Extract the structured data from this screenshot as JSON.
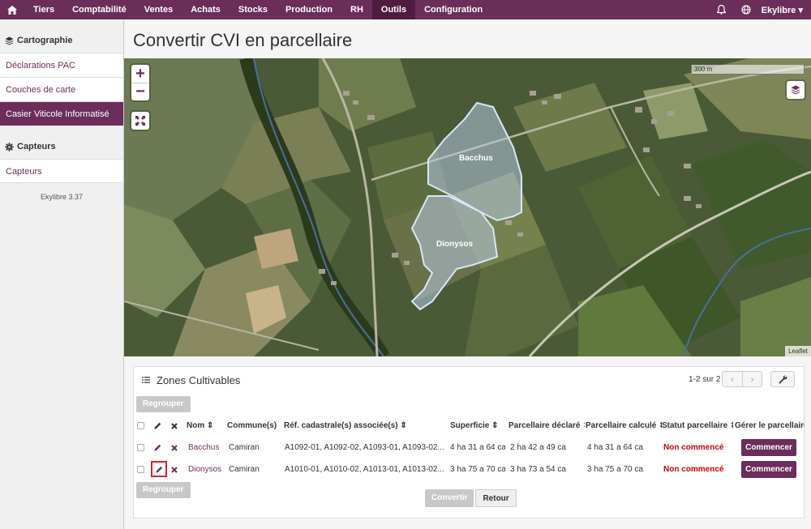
{
  "nav": {
    "items": [
      "Tiers",
      "Comptabilité",
      "Ventes",
      "Achats",
      "Stocks",
      "Production",
      "RH",
      "Outils",
      "Configuration"
    ],
    "active": "Outils",
    "user": "Ekylibre ▾"
  },
  "sidebar": {
    "section1": "Cartographie",
    "items1": [
      "Déclarations PAC",
      "Couches de carte",
      "Casier Viticole Informatisé"
    ],
    "section2": "Capteurs",
    "items2": [
      "Capteurs"
    ],
    "version": "Ekylibre 3.37"
  },
  "page": {
    "title": "Convertir CVI en parcellaire"
  },
  "map": {
    "scale_label": "300 m",
    "attribution": "Leaflet",
    "parcels": [
      "Bacchus",
      "Dionysos"
    ]
  },
  "panel": {
    "title": "Zones Cultivables",
    "count": "1-2 sur 2",
    "group_button": "Regrouper",
    "columns": {
      "name": "Nom ⇕",
      "commune": "Commune(s) ⇕",
      "ref": "Réf. cadastrale(s) associée(s) ⇕",
      "surface": "Superficie ⇕",
      "declared": "Parcellaire déclaré ⇕",
      "computed": "Parcellaire calculé ⇕",
      "status": "Statut parcellaire ⇕",
      "manage": "Gérer le parcellaire"
    },
    "rows": [
      {
        "name": "Bacchus",
        "commune": "Camiran",
        "ref": "A1092-01, A1092-02, A1093-01, A1093-02...",
        "surface": "4 ha 31 a 64 ca",
        "declared": "2 ha 42 a 49 ca",
        "computed": "4 ha 31 a 64 ca",
        "status": "Non commencé",
        "action": "Commencer"
      },
      {
        "name": "Dionysos",
        "commune": "Camiran",
        "ref": "A1010-01, A1010-02, A1013-01, A1013-02...",
        "surface": "3 ha 75 a 70 ca",
        "declared": "3 ha 73 a 54 ca",
        "computed": "3 ha 75 a 70 ca",
        "status": "Non commencé",
        "action": "Commencer"
      }
    ]
  },
  "footer": {
    "convert": "Convertir",
    "back": "Retour"
  }
}
